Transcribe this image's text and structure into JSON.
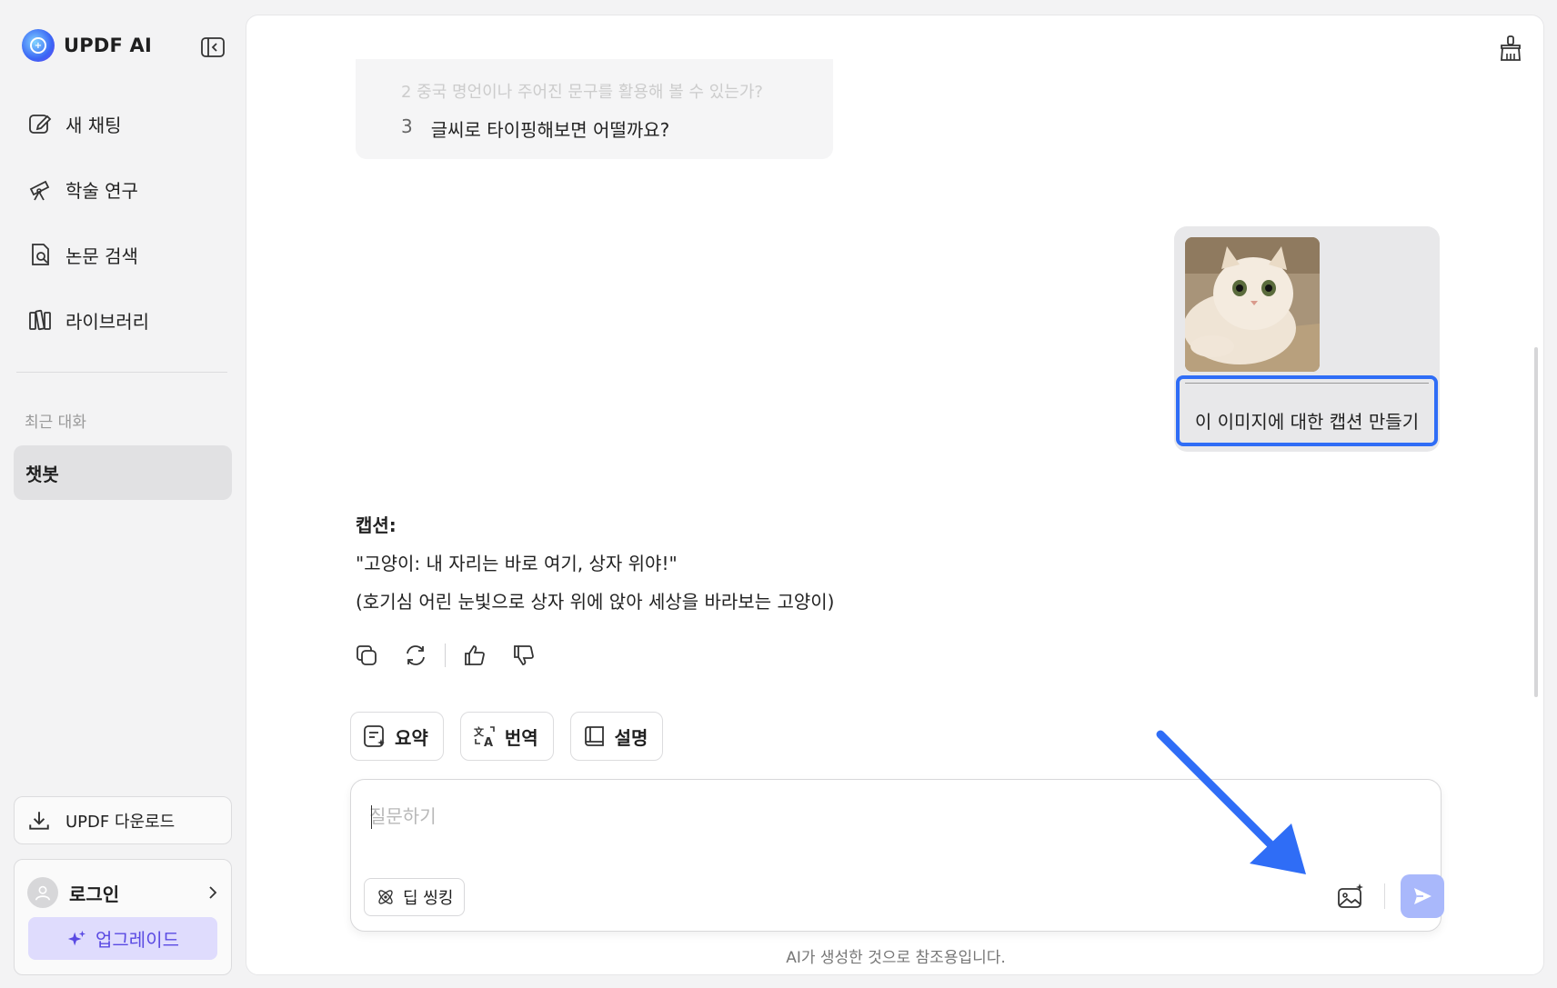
{
  "sidebar": {
    "brand": "UPDF AI",
    "nav": [
      {
        "label": "새 채팅",
        "icon": "edit-icon"
      },
      {
        "label": "학술 연구",
        "icon": "telescope-icon"
      },
      {
        "label": "논문 검색",
        "icon": "document-search-icon"
      },
      {
        "label": "라이브러리",
        "icon": "library-icon"
      }
    ],
    "recent_label": "최근 대화",
    "recent_items": [
      "챗봇"
    ],
    "download_label": "UPDF 다운로드",
    "login_label": "로그인",
    "upgrade_label": "업그레이드"
  },
  "chat": {
    "prev_faded": "2   중국 명언이나 주어진 문구를 활용해 볼 수 있는가?",
    "prev_line_num": "3",
    "prev_line_text": "글씨로 타이핑해보면 어떨까요?",
    "user_message": "이 이미지에 대한 캡션 만들기",
    "answer_title": "캡션:",
    "answer_line1": "\"고양이: 내 자리는 바로 여기, 상자 위야!\"",
    "answer_line2": "(호기심 어린 눈빛으로 상자 위에 앉아 세상을 바라보는 고양이)"
  },
  "quick_actions": [
    {
      "label": "요약",
      "icon": "summary-icon"
    },
    {
      "label": "번역",
      "icon": "translate-icon"
    },
    {
      "label": "설명",
      "icon": "book-icon"
    }
  ],
  "composer": {
    "placeholder": "질문하기",
    "deep_thinking_label": "딥 씽킹"
  },
  "footnote": "AI가 생성한 것으로 참조용입니다.",
  "colors": {
    "accent": "#2f6df6",
    "send_button": "#a9b8fb",
    "upgrade_bg": "#dfdcfd",
    "upgrade_text": "#5a4ae3"
  }
}
